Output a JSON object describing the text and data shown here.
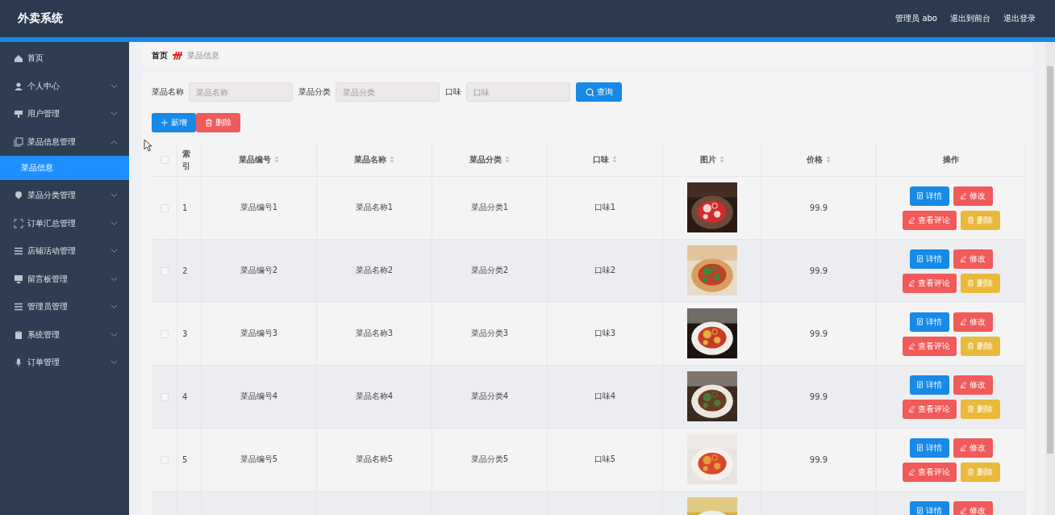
{
  "app_title": "外卖系统",
  "header_links": [
    "管理员 abo",
    "退出到前台",
    "退出登录"
  ],
  "sidebar": {
    "items": [
      {
        "label": "首页"
      },
      {
        "label": "个人中心",
        "expanded": false
      },
      {
        "label": "用户管理",
        "expanded": false
      },
      {
        "label": "菜品信息管理",
        "expanded": true,
        "children": [
          {
            "label": "菜品信息",
            "selected": true
          }
        ]
      },
      {
        "label": "菜品分类管理",
        "expanded": false
      },
      {
        "label": "订单汇总管理",
        "expanded": false
      },
      {
        "label": "店铺活动管理",
        "expanded": false
      },
      {
        "label": "留言板管理",
        "expanded": false
      },
      {
        "label": "管理员管理",
        "expanded": false
      },
      {
        "label": "系统管理",
        "expanded": false
      },
      {
        "label": "订单管理",
        "expanded": false
      }
    ]
  },
  "breadcrumb": {
    "home": "首页",
    "current": "菜品信息"
  },
  "search": {
    "fields": [
      {
        "label": "菜品名称",
        "placeholder": "菜品名称"
      },
      {
        "label": "菜品分类",
        "placeholder": "菜品分类"
      },
      {
        "label": "口味",
        "placeholder": "口味"
      }
    ],
    "button": "查询"
  },
  "toolbar": [
    {
      "kind": "add",
      "label": "新增"
    },
    {
      "kind": "delete",
      "label": "删除"
    }
  ],
  "table": {
    "select_all": {
      "checked": false
    },
    "columns": [
      {
        "label": "索引",
        "sortable": false
      },
      {
        "label": "菜品编号",
        "sortable": true
      },
      {
        "label": "菜品名称",
        "sortable": true
      },
      {
        "label": "菜品分类",
        "sortable": true
      },
      {
        "label": "口味",
        "sortable": true
      },
      {
        "label": "图片",
        "sortable": true
      },
      {
        "label": "价格",
        "sortable": true
      },
      {
        "label": "操作",
        "sortable": false
      }
    ],
    "rows": [
      {
        "checked": false,
        "cells": [
          "1",
          "菜品编号1",
          "菜品名称1",
          "菜品分类1",
          "口味1"
        ],
        "image": {
          "kind": "picture"
        },
        "price": "99.9",
        "actions": [
          {
            "kind": "detail",
            "label": "详情"
          },
          {
            "kind": "edit",
            "label": "修改"
          },
          {
            "kind": "review",
            "label": "查看评论"
          },
          {
            "kind": "delete",
            "label": "删除"
          }
        ]
      },
      {
        "checked": false,
        "cells": [
          "2",
          "菜品编号2",
          "菜品名称2",
          "菜品分类2",
          "口味2"
        ],
        "image": {
          "kind": "picture"
        },
        "price": "99.9",
        "actions": [
          {
            "kind": "detail",
            "label": "详情"
          },
          {
            "kind": "edit",
            "label": "修改"
          },
          {
            "kind": "review",
            "label": "查看评论"
          },
          {
            "kind": "delete",
            "label": "删除"
          }
        ]
      },
      {
        "checked": false,
        "cells": [
          "3",
          "菜品编号3",
          "菜品名称3",
          "菜品分类3",
          "口味3"
        ],
        "image": {
          "kind": "picture"
        },
        "price": "99.9",
        "actions": [
          {
            "kind": "detail",
            "label": "详情"
          },
          {
            "kind": "edit",
            "label": "修改"
          },
          {
            "kind": "review",
            "label": "查看评论"
          },
          {
            "kind": "delete",
            "label": "删除"
          }
        ]
      },
      {
        "checked": false,
        "cells": [
          "4",
          "菜品编号4",
          "菜品名称4",
          "菜品分类4",
          "口味4"
        ],
        "image": {
          "kind": "picture"
        },
        "price": "99.9",
        "actions": [
          {
            "kind": "detail",
            "label": "详情"
          },
          {
            "kind": "edit",
            "label": "修改"
          },
          {
            "kind": "review",
            "label": "查看评论"
          },
          {
            "kind": "delete",
            "label": "删除"
          }
        ]
      },
      {
        "checked": false,
        "cells": [
          "5",
          "菜品编号5",
          "菜品名称5",
          "菜品分类5",
          "口味5"
        ],
        "image": {
          "kind": "picture"
        },
        "price": "99.9",
        "actions": [
          {
            "kind": "detail",
            "label": "详情"
          },
          {
            "kind": "edit",
            "label": "修改"
          },
          {
            "kind": "review",
            "label": "查看评论"
          },
          {
            "kind": "delete",
            "label": "删除"
          }
        ]
      },
      {
        "image": {
          "kind": "picture"
        },
        "actions": [
          {
            "kind": "detail",
            "label": "详情"
          },
          {
            "kind": "edit",
            "label": "修改"
          }
        ]
      }
    ]
  }
}
